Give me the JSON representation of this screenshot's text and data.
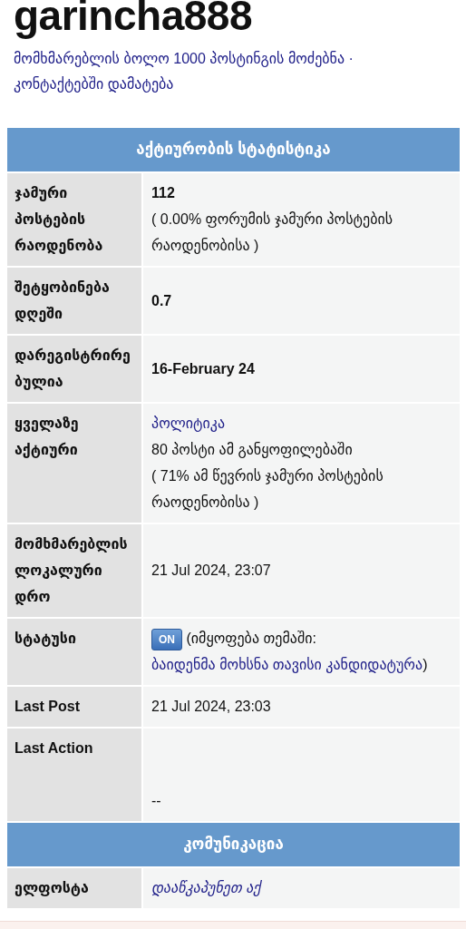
{
  "username": "garincha888",
  "user_links": [
    {
      "text": "მომხმარებლის ბოლო 1000 პოსტინგის მოძებნა"
    },
    {
      "text": "კონტაქტებში დამატება"
    }
  ],
  "link_separator": "·",
  "sections": [
    {
      "title": "აქტიურობის სტატისტიკა",
      "rows": [
        {
          "label": "ჯამური პოსტების რაოდენობა",
          "kind": "top",
          "lines": [
            [
              {
                "text": "112",
                "kind": "strong"
              }
            ],
            [
              {
                "text": "( 0.00% ფორუმის ჯამური პოსტების რაოდენობისა )",
                "kind": "text"
              }
            ]
          ]
        },
        {
          "label": "შეტყობინება დღეში",
          "kind": "middle",
          "lines": [
            [
              {
                "text": "0.7",
                "kind": "strong"
              }
            ]
          ]
        },
        {
          "label": "დარეგისტრირებულია",
          "kind": "middle",
          "lines": [
            [
              {
                "text": "16-February 24",
                "kind": "strong"
              }
            ]
          ]
        },
        {
          "label": "ყველაზე აქტიური",
          "kind": "top",
          "lines": [
            [
              {
                "text": "პოლიტიკა",
                "kind": "link"
              }
            ],
            [
              {
                "text": "80 პოსტი ამ განყოფილებაში",
                "kind": "text"
              }
            ],
            [
              {
                "text": "( 71% ამ წევრის ჯამური პოსტების რაოდენობისა )",
                "kind": "text"
              }
            ]
          ]
        },
        {
          "label": "მომხმარებლის ლოკალური დრო",
          "kind": "middle",
          "lines": [
            [
              {
                "text": "21 Jul 2024, 23:07",
                "kind": "text"
              }
            ]
          ]
        },
        {
          "label": "სტატუსი",
          "kind": "top",
          "lines": [
            [
              {
                "text": "ON",
                "kind": "badge",
                "on": true
              },
              {
                "text": " (იმყოფება თემაში: ",
                "kind": "text"
              },
              {
                "text": "ბაიდენმა მოხსნა თავისი კანდიდატურა",
                "kind": "link"
              },
              {
                "text": ")",
                "kind": "text"
              }
            ]
          ]
        },
        {
          "label": "Last Post",
          "kind": "top",
          "lines": [
            [
              {
                "text": "21 Jul 2024, 23:03",
                "kind": "text"
              }
            ]
          ]
        },
        {
          "label": "Last Action",
          "kind": "bottom",
          "lines": [
            [
              {
                "text": "--",
                "kind": "text"
              }
            ]
          ]
        }
      ]
    },
    {
      "title": "კომუნიკაცია",
      "rows": [
        {
          "label": "ელფოსტა",
          "kind": "top",
          "lines": [
            [
              {
                "text": "დააწკაპუნეთ აქ",
                "kind": "italic-link"
              }
            ]
          ]
        }
      ]
    }
  ]
}
